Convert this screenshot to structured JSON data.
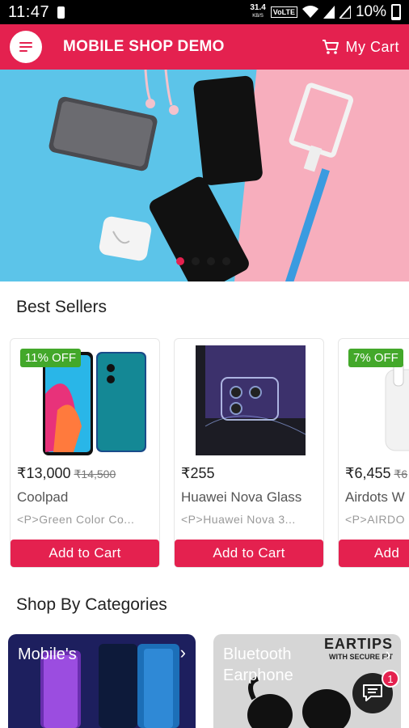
{
  "status_bar": {
    "time": "11:47",
    "net_speed": "31.4",
    "net_unit": "KB/S",
    "volte": "VoLTE",
    "battery_pct": "10%"
  },
  "appbar": {
    "title": "MOBILE SHOP DEMO",
    "cart_label": "My Cart"
  },
  "banner": {
    "slide_count": 4,
    "active_slide": 1
  },
  "best_sellers": {
    "title": "Best Sellers",
    "products": [
      {
        "discount": "11% OFF",
        "price": "₹13,000",
        "old_price": "₹14,500",
        "name": "Coolpad",
        "desc": "<P>Green Color Co...",
        "button": "Add to Cart"
      },
      {
        "discount": "",
        "price": "₹255",
        "old_price": "",
        "name": "Huawei Nova Glass",
        "desc": "<P>Huawei Nova 3...",
        "button": "Add to Cart"
      },
      {
        "discount": "7% OFF",
        "price": "₹6,455",
        "old_price": "₹6",
        "name": "Airdots W",
        "desc": "<P>AIRDO",
        "button": "Add"
      }
    ]
  },
  "categories": {
    "title": "Shop By Categories",
    "items": [
      {
        "label": "Mobile's"
      },
      {
        "label_line1": "Bluetooth",
        "label_line2": "Earphone",
        "promo_line1": "EARTIPS",
        "promo_line2": "WITH SECURE FIT"
      }
    ]
  },
  "chat": {
    "badge": "1"
  },
  "colors": {
    "brand": "#e4214f",
    "discount": "#43a82a"
  }
}
